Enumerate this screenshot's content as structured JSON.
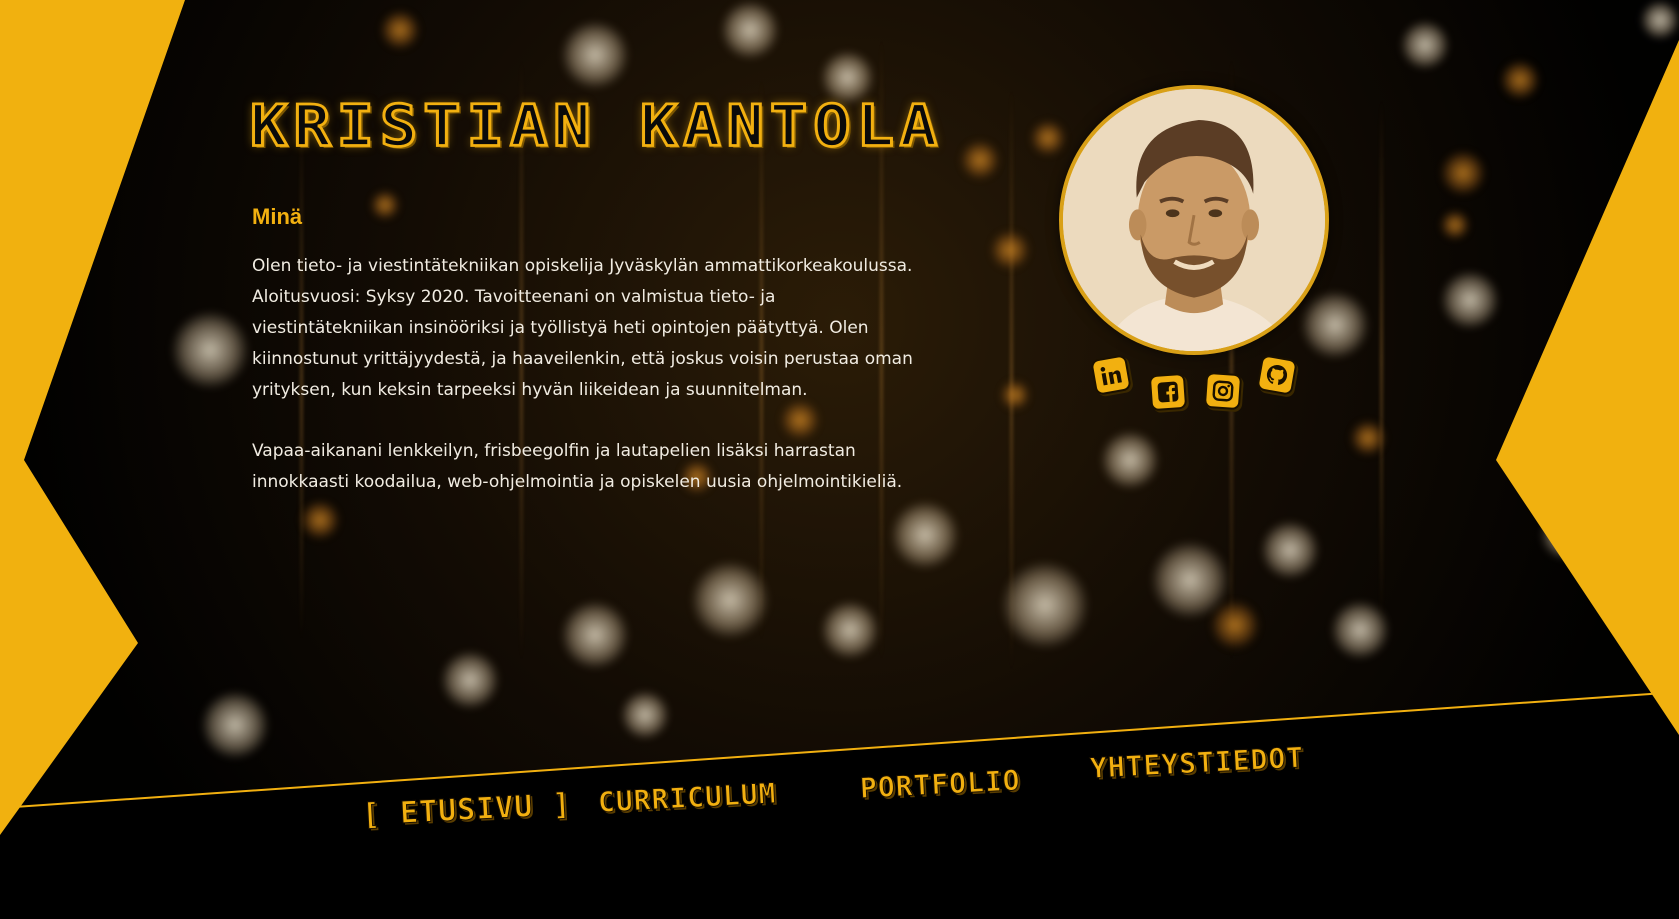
{
  "header": {
    "name": "KRISTIAN KANTOLA"
  },
  "about": {
    "heading": "Minä",
    "paragraphs": [
      "Olen tieto- ja viestintätekniikan opiskelija Jyväskylän ammattikorkeakoulussa. Aloitusvuosi: Syksy 2020. Tavoitteenani on valmistua tieto- ja viestintätekniikan insinööriksi ja työllistyä heti opintojen päätyttyä. Olen kiinnostunut yrittäjyydestä, ja haaveilenkin, että joskus voisin perustaa oman yrityksen, kun keksin tarpeeksi hyvän liikeidean ja suunnitelman.",
      "Vapaa-aikanani lenkkeilyn, frisbeegolfin ja lautapelien lisäksi harrastan innokkaasti koodailua, web-ohjelmointia ja opiskelen uusia ohjelmointikieliä."
    ]
  },
  "social": [
    {
      "name": "linkedin",
      "icon": "linkedin-icon"
    },
    {
      "name": "facebook",
      "icon": "facebook-icon"
    },
    {
      "name": "instagram",
      "icon": "instagram-icon"
    },
    {
      "name": "github",
      "icon": "github-icon"
    }
  ],
  "nav": {
    "etusivu": "[ ETUSIVU ]",
    "curriculum": "CURRICULUM",
    "portfolio": "PORTFOLIO",
    "yhteystiedot": "YHTEYSTIEDOT"
  },
  "colors": {
    "accent": "#f2b010",
    "background": "#000000",
    "text": "#f1ece2"
  }
}
